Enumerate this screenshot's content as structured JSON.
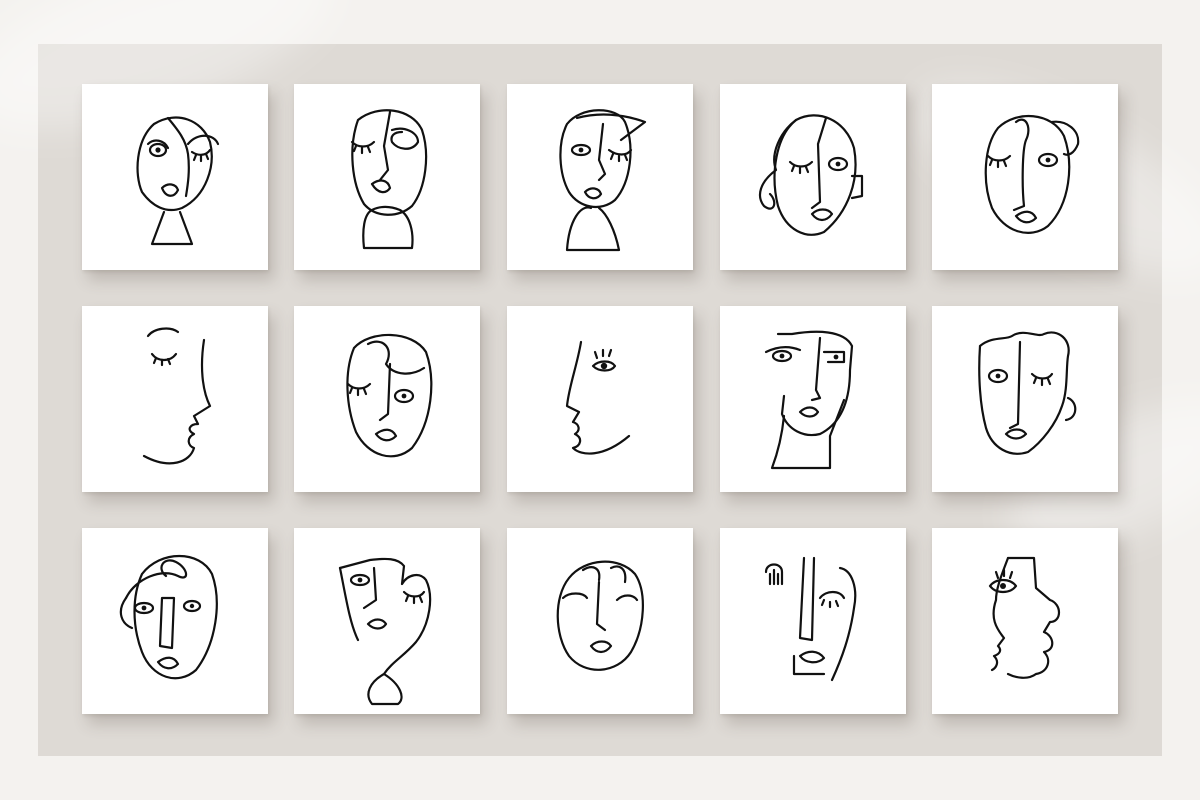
{
  "scene": {
    "background_color": "#f4f2ef",
    "mat_color": "#dedad5",
    "card_color": "#ffffff",
    "line_color": "#111111"
  },
  "grid": {
    "rows": 3,
    "columns": 5,
    "cards": [
      {
        "row": 1,
        "col": 1,
        "icon": "face-line-art-bust-winking-icon"
      },
      {
        "row": 1,
        "col": 2,
        "icon": "face-line-art-bust-closed-eye-icon"
      },
      {
        "row": 1,
        "col": 3,
        "icon": "face-line-art-hat-bust-icon"
      },
      {
        "row": 1,
        "col": 4,
        "icon": "face-line-art-wavy-hair-icon"
      },
      {
        "row": 1,
        "col": 5,
        "icon": "face-line-art-winking-ear-icon"
      },
      {
        "row": 2,
        "col": 1,
        "icon": "face-line-art-profile-closed-eye-icon"
      },
      {
        "row": 2,
        "col": 2,
        "icon": "face-line-art-curl-hair-icon"
      },
      {
        "row": 2,
        "col": 3,
        "icon": "face-line-art-profile-open-eye-icon"
      },
      {
        "row": 2,
        "col": 4,
        "icon": "face-line-art-angular-neck-icon"
      },
      {
        "row": 2,
        "col": 5,
        "icon": "face-line-art-wavy-top-icon"
      },
      {
        "row": 3,
        "col": 1,
        "icon": "face-line-art-loop-hair-icon"
      },
      {
        "row": 3,
        "col": 2,
        "icon": "face-line-art-split-face-icon"
      },
      {
        "row": 3,
        "col": 3,
        "icon": "face-line-art-oval-mask-icon"
      },
      {
        "row": 3,
        "col": 4,
        "icon": "face-line-art-comb-eye-icon"
      },
      {
        "row": 3,
        "col": 5,
        "icon": "face-line-art-profile-cubist-icon"
      }
    ]
  }
}
